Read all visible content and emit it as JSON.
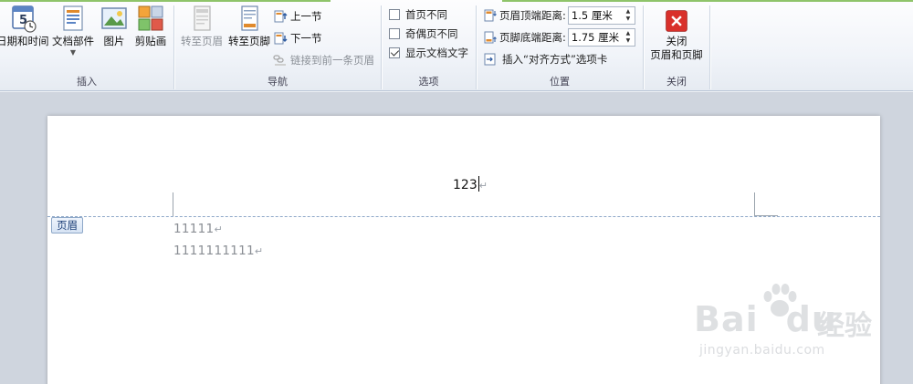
{
  "ribbon": {
    "insert_group": {
      "label": "插入",
      "date_time": "日期和时间",
      "quick_parts": "文档部件",
      "picture": "图片",
      "clip_art": "剪贴画"
    },
    "nav_group": {
      "label": "导航",
      "goto_header": "转至页眉",
      "goto_footer": "转至页脚",
      "prev_section": "上一节",
      "next_section": "下一节",
      "link_previous": "链接到前一条页眉"
    },
    "options_group": {
      "label": "选项",
      "different_first_page": "首页不同",
      "different_odd_even": "奇偶页不同",
      "show_document_text": "显示文档文字"
    },
    "position_group": {
      "label": "位置",
      "header_from_top_label": "页眉顶端距离:",
      "header_from_top_value": "1.5 厘米",
      "footer_from_bottom_label": "页脚底端距离:",
      "footer_from_bottom_value": "1.75 厘米",
      "insert_alignment_tab": "插入“对齐方式”选项卡"
    },
    "close_group": {
      "label": "关闭",
      "close_line1": "关闭",
      "close_line2": "页眉和页脚"
    }
  },
  "document": {
    "header_tag": "页眉",
    "header_text": "123",
    "body_lines": [
      "11111",
      "1111111111"
    ],
    "paragraph_mark": "↵"
  },
  "watermark": {
    "logo_text": "Bai",
    "logo_text2": "du",
    "cn_text": "经验",
    "url": "jingyan.baidu.com"
  },
  "icons": {
    "date_time": "calendar-clock-icon",
    "quick_parts": "document-parts-icon",
    "picture": "picture-icon",
    "clip_art": "clip-art-icon",
    "goto_header": "goto-header-icon",
    "goto_footer": "goto-footer-icon",
    "close": "close-x-icon"
  },
  "colors": {
    "accent_green": "#8fc46a",
    "close_red": "#d9302b",
    "header_dash": "#8ea8c8"
  }
}
